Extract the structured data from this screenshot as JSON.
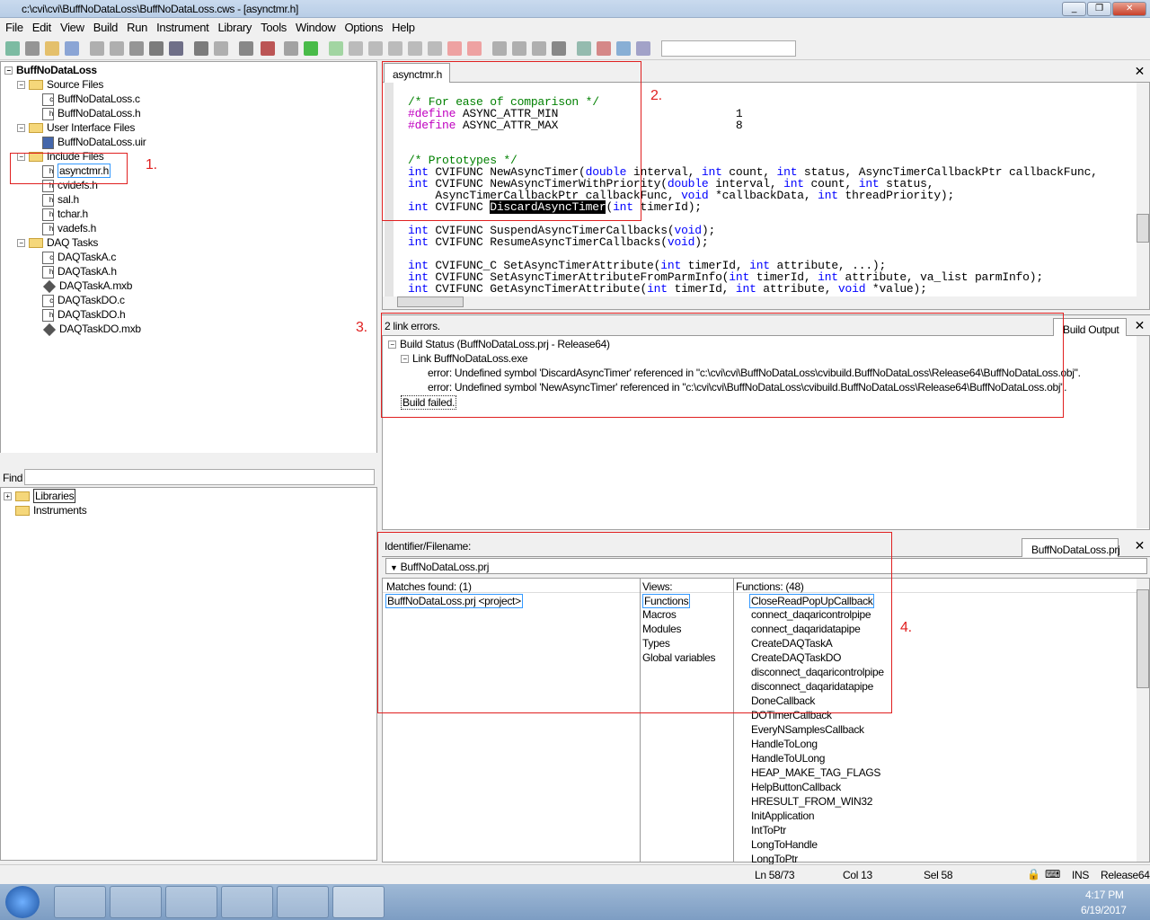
{
  "window": {
    "title": "c:\\cvi\\cvi\\BuffNoDataLoss\\BuffNoDataLoss.cws - [asynctmr.h]"
  },
  "menu": [
    "File",
    "Edit",
    "View",
    "Build",
    "Run",
    "Instrument",
    "Library",
    "Tools",
    "Window",
    "Options",
    "Help"
  ],
  "project_tree": {
    "root": "BuffNoDataLoss",
    "items": [
      {
        "label": "Source Files",
        "type": "folder",
        "level": 1
      },
      {
        "label": "BuffNoDataLoss.c",
        "type": "c",
        "level": 2
      },
      {
        "label": "BuffNoDataLoss.h",
        "type": "h",
        "level": 2
      },
      {
        "label": "User Interface Files",
        "type": "folder",
        "level": 1
      },
      {
        "label": "BuffNoDataLoss.uir",
        "type": "uir",
        "level": 2
      },
      {
        "label": "Include Files",
        "type": "folder",
        "level": 1
      },
      {
        "label": "asynctmr.h",
        "type": "h",
        "level": 2,
        "selected": true
      },
      {
        "label": "cvidefs.h",
        "type": "h",
        "level": 2
      },
      {
        "label": "sal.h",
        "type": "h",
        "level": 2
      },
      {
        "label": "tchar.h",
        "type": "h",
        "level": 2
      },
      {
        "label": "vadefs.h",
        "type": "h",
        "level": 2
      },
      {
        "label": "DAQ Tasks",
        "type": "folder",
        "level": 1
      },
      {
        "label": "DAQTaskA.c",
        "type": "c",
        "level": 2
      },
      {
        "label": "DAQTaskA.h",
        "type": "h",
        "level": 2
      },
      {
        "label": "DAQTaskA.mxb",
        "type": "mxb",
        "level": 2
      },
      {
        "label": "DAQTaskDO.c",
        "type": "c",
        "level": 2
      },
      {
        "label": "DAQTaskDO.h",
        "type": "h",
        "level": 2
      },
      {
        "label": "DAQTaskDO.mxb",
        "type": "mxb",
        "level": 2
      }
    ]
  },
  "find": {
    "label": "Find",
    "value": ""
  },
  "library_tree": [
    "Libraries",
    "Instruments"
  ],
  "editor": {
    "tab": "asynctmr.h",
    "close": "x"
  },
  "build_output": {
    "summary": "2 link errors.",
    "tab": "Build Output",
    "close": "x",
    "lines": [
      "Build Status (BuffNoDataLoss.prj - Release64)",
      "Link BuffNoDataLoss.exe",
      "error: Undefined symbol 'DiscardAsyncTimer' referenced in \"c:\\cvi\\cvi\\BuffNoDataLoss\\cvibuild.BuffNoDataLoss\\Release64\\BuffNoDataLoss.obj\".",
      "error: Undefined symbol 'NewAsyncTimer' referenced in \"c:\\cvi\\cvi\\BuffNoDataLoss\\cvibuild.BuffNoDataLoss\\Release64\\BuffNoDataLoss.obj\".",
      "Build failed."
    ]
  },
  "source_browser": {
    "label": "Identifier/Filename:",
    "tab": "BuffNoDataLoss.prj",
    "close": "x",
    "dropdown": "BuffNoDataLoss.prj",
    "matches_label": "Matches found: (1)",
    "matches": [
      "BuffNoDataLoss.prj <project>"
    ],
    "views_label": "Views:",
    "views": [
      "Functions",
      "Macros",
      "Modules",
      "Types",
      "Global variables"
    ],
    "functions_label": "Functions: (48)",
    "functions": [
      "CloseReadPopUpCallback",
      "connect_daqaricontrolpipe",
      "connect_daqaridatapipe",
      "CreateDAQTaskA",
      "CreateDAQTaskDO",
      "disconnect_daqaricontrolpipe",
      "disconnect_daqaridatapipe",
      "DoneCallback",
      "DOTimerCallback",
      "EveryNSamplesCallback",
      "HandleToLong",
      "HandleToULong",
      "HEAP_MAKE_TAG_FLAGS",
      "HelpButtonCallback",
      "HRESULT_FROM_WIN32",
      "InitApplication",
      "IntToPtr",
      "LongToHandle",
      "LongToPtr"
    ]
  },
  "annotations": [
    "1.",
    "2.",
    "3.",
    "4."
  ],
  "status": {
    "line": "Ln 58/73",
    "col": "Col 13",
    "sel": "Sel 58",
    "mode": "INS",
    "config": "Release64"
  },
  "taskbar": {
    "time": "4:17 PM",
    "date": "6/19/2017"
  }
}
